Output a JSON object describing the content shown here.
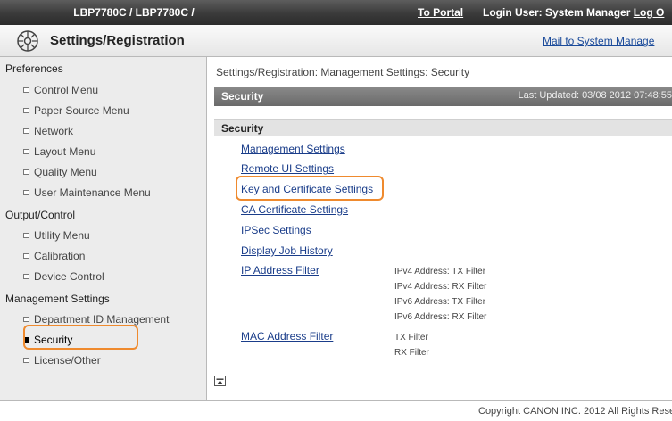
{
  "topbar": {
    "title": "LBP7780C / LBP7780C /",
    "portal": "To Portal",
    "login_label": "Login User: System Manager",
    "logout": "Log O"
  },
  "header": {
    "icon": "settings-gear-icon",
    "title": "Settings/Registration",
    "mail": "Mail to System Manage"
  },
  "sidebar": {
    "groups": [
      "Preferences",
      "Output/Control",
      "Management Settings"
    ],
    "items": [
      "Control Menu",
      "Paper Source Menu",
      "Network",
      "Layout Menu",
      "Quality Menu",
      "User Maintenance Menu",
      "Utility Menu",
      "Calibration",
      "Device Control",
      "Department ID Management",
      "Security",
      "License/Other"
    ],
    "active": "Security"
  },
  "main": {
    "breadcrumb": "Settings/Registration: Management Settings: Security",
    "section_title": "Security",
    "last_updated": "Last Updated: 03/08 2012 07:48:55",
    "subsection_title": "Security",
    "links": [
      "Management Settings",
      "Remote UI Settings",
      "Key and Certificate Settings",
      "CA Certificate Settings",
      "IPSec Settings",
      "Display Job History",
      "IP Address Filter",
      "MAC Address Filter"
    ],
    "ip_filter_items": [
      "IPv4 Address: TX Filter",
      "IPv4 Address: RX Filter",
      "IPv6 Address: TX Filter",
      "IPv6 Address: RX Filter"
    ],
    "mac_filter_items": [
      "TX Filter",
      "RX Filter"
    ],
    "highlight_color": "#ef8a2e"
  },
  "footer": {
    "copyright": "Copyright CANON INC. 2012 All Rights Reserve"
  }
}
